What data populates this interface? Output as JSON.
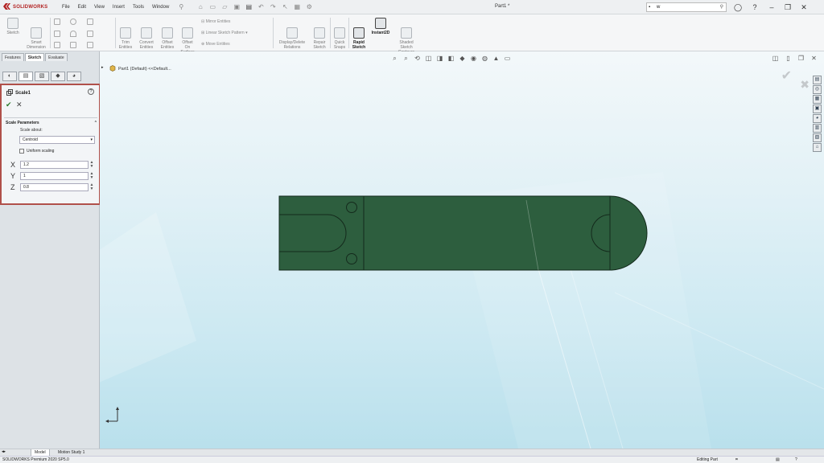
{
  "app": {
    "logo_text": "SOLIDWORKS",
    "menus": [
      "File",
      "Edit",
      "View",
      "Insert",
      "Tools",
      "Window"
    ],
    "doc_title": "Part1 *",
    "search_placeholder": "w"
  },
  "ribbon": {
    "sketch": "Sketch",
    "smart_dimension": "Smart\nDimension",
    "trim_entities": "Trim\nEntities",
    "convert_entities": "Convert\nEntities",
    "offset_entities": "Offset\nEntities",
    "offset_on_surface": "Offset\nOn\nSurface",
    "mirror_entities": "Mirror Entities",
    "linear_sketch_pattern": "Linear Sketch Pattern",
    "move_entities": "Move Entities",
    "display_delete_relations": "Display/Delete\nRelations",
    "repair_sketch": "Repair\nSketch",
    "quick_snaps": "Quick\nSnaps",
    "rapid_sketch": "Rapid\nSketch",
    "instant2d": "Instant2D",
    "shaded_sketch_contours": "Shaded\nSketch\nContours"
  },
  "command_tabs": [
    "Features",
    "Sketch",
    "Evaluate"
  ],
  "property_manager": {
    "title": "Scale1",
    "group_title": "Scale Parameters",
    "scale_about_label": "Scale about:",
    "scale_about_value": "Centroid",
    "uniform_scaling_label": "Uniform scaling",
    "uniform_scaling_checked": false,
    "axes": [
      {
        "label": "X",
        "value": "1.2"
      },
      {
        "label": "Y",
        "value": "1"
      },
      {
        "label": "Z",
        "value": "0.8"
      }
    ]
  },
  "viewport": {
    "tree_text": "Part1 (Default) <<Default..."
  },
  "bottom_tabs": [
    "Model",
    "Motion Study 1"
  ],
  "status": {
    "left": "SOLIDWORKS Premium 2020 SP5.0",
    "right": "Editing Part"
  },
  "colors": {
    "part_fill": "#2d5e3e",
    "pm_border": "#b0504a",
    "viewport_top": "#f3f8fa",
    "viewport_bottom": "#b9e0ec"
  }
}
